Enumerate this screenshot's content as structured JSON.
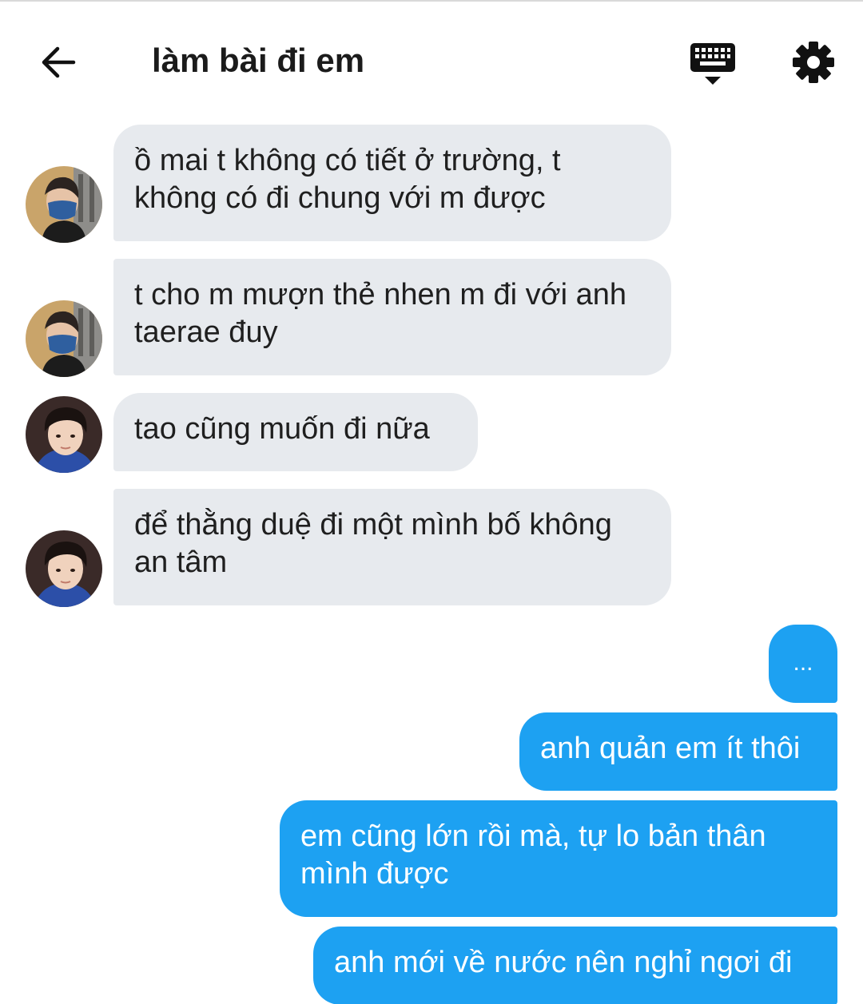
{
  "header": {
    "title": "làm bài đi em"
  },
  "icons": {
    "back": "arrow-left-icon",
    "keyboard": "keyboard-icon",
    "settings": "gear-icon"
  },
  "colors": {
    "incoming_bubble": "#e7eaee",
    "outgoing_bubble": "#1da1f2"
  },
  "messages": [
    {
      "side": "incoming",
      "text": "ồ mai t không có tiết ở trường, t không có đi chung với m được"
    },
    {
      "side": "incoming",
      "text": "t cho m mượn thẻ nhen m đi với anh taerae đuy"
    },
    {
      "side": "incoming",
      "text": "tao cũng muốn đi nữa"
    },
    {
      "side": "incoming",
      "text": "để thằng duệ đi một mình bố không an tâm"
    },
    {
      "side": "outgoing",
      "text": "..."
    },
    {
      "side": "outgoing",
      "text": "anh quản em ít thôi"
    },
    {
      "side": "outgoing",
      "text": "em cũng lớn rồi mà, tự lo bản thân mình được"
    },
    {
      "side": "outgoing",
      "text": "anh mới về nước nên nghỉ ngơi đi"
    }
  ]
}
